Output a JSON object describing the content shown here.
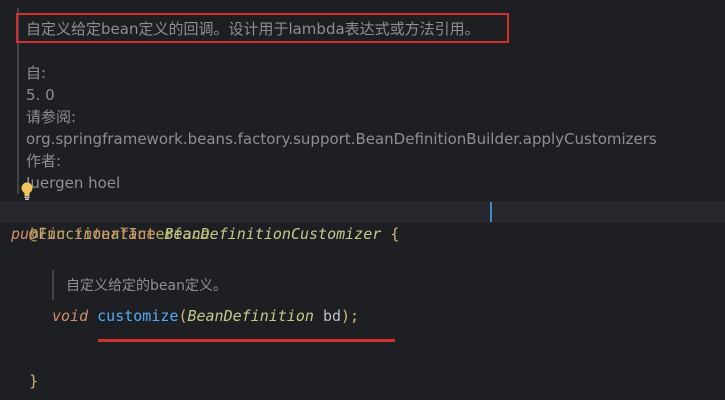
{
  "doc": {
    "summary": "自定义给定bean定义的回调。设计用于lambda表达式或方法引用。",
    "since_label": "自:",
    "since_value": "5. 0",
    "see_label": "请参阅:",
    "see_value": "org.springframework.beans.factory.support.BeanDefinitionBuilder.applyCustomizers",
    "author_label": "作者:",
    "author_value": "Juergen hoel"
  },
  "code": {
    "annotation": "@FunctionalInterface",
    "kw_public": "public",
    "kw_interface": "interface",
    "interface_name": "BeanDefinitionCustomizer",
    "open_brace": "{",
    "method_doc": "自定义给定的bean定义。",
    "kw_void": "void",
    "method_name": "customize",
    "open_paren": "(",
    "param_type": "BeanDefinition",
    "param_name": "bd",
    "close_paren_semicolon": ");",
    "close_brace": "}"
  },
  "colors": {
    "background": "#1e1f22",
    "highlight_border": "#d32f2f",
    "doc_text": "#8c8f94",
    "keyword": "#cf8e6d",
    "method": "#56a8f5",
    "annotation": "#b3ae60"
  },
  "icons": {
    "intention_bulb": "lightbulb-icon"
  }
}
